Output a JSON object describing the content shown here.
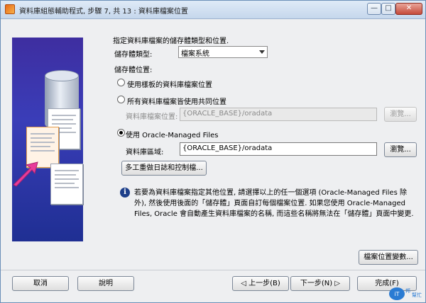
{
  "window": {
    "title": "資料庫組態輔助程式, 步驟 7, 共 13 : 資料庫檔案位置",
    "controls": {
      "minimize": "—",
      "maximize": "□",
      "close": "✕"
    }
  },
  "heading": "指定資料庫檔案的儲存體類型和位置.",
  "storage_type": {
    "label": "儲存體類型:",
    "value": "檔案系統"
  },
  "storage_location_label": "儲存體位置:",
  "options": {
    "template_label": "使用樣板的資料庫檔案位置",
    "common_label": "所有資料庫檔案皆使用共同位置",
    "common_location_label": "資料庫檔案位置:",
    "common_location_value": "{ORACLE_BASE}/oradata",
    "omf_label": "使用 Oracle-Managed Files",
    "omf_area_label": "資料庫區域:",
    "omf_area_value": "{ORACLE_BASE}/oradata"
  },
  "browse_label": "瀏覽...",
  "multiplex_label": "多工重做日誌和控制檔...",
  "info_text": "若要為資料庫檔案指定其他位置, 請選擇以上的任一個選項 (Oracle-Managed Files 除外), 然後使用後面的「儲存體」頁面自訂每個檔案位置. 如果您使用 Oracle-Managed Files, Oracle 會自動產生資料庫檔案的名稱, 而這些名稱將無法在「儲存體」頁面中變更.",
  "file_location_vars_label": "檔案位置變數...",
  "footer": {
    "cancel": "取消",
    "help": "說明",
    "back": "上一步(B)",
    "next": "下一步(N)",
    "finish": "完成(F)"
  },
  "watermark": "iT邦幫忙",
  "colors": {
    "panel": "#3a3db8",
    "info_icon": "#1d3f8a",
    "selected_radio": "#000000"
  }
}
